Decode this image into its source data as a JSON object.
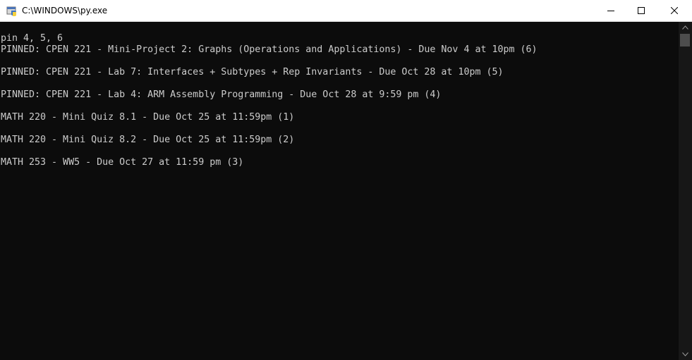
{
  "window": {
    "title": "C:\\WINDOWS\\py.exe",
    "app_icon": "python-icon"
  },
  "controls": {
    "minimize_icon": "minimize-icon",
    "maximize_icon": "maximize-icon",
    "close_icon": "close-icon"
  },
  "console": {
    "lines": [
      "pin 4, 5, 6",
      "PINNED: CPEN 221 - Mini-Project 2: Graphs (Operations and Applications) - Due Nov 4 at 10pm (6)",
      "",
      "PINNED: CPEN 221 - Lab 7: Interfaces + Subtypes + Rep Invariants - Due Oct 28 at 10pm (5)",
      "",
      "PINNED: CPEN 221 - Lab 4: ARM Assembly Programming - Due Oct 28 at 9:59 pm (4)",
      "",
      "MATH 220 - Mini Quiz 8.1 - Due Oct 25 at 11:59pm (1)",
      "",
      "MATH 220 - Mini Quiz 8.2 - Due Oct 25 at 11:59pm (2)",
      "",
      "MATH 253 - WW5 - Due Oct 27 at 11:59 pm (3)"
    ]
  },
  "colors": {
    "console_bg": "#0c0c0c",
    "console_text": "#cccccc",
    "titlebar_bg": "#ffffff",
    "scrollbar_bg": "#171717",
    "scrollbar_thumb": "#4d4d4d"
  }
}
